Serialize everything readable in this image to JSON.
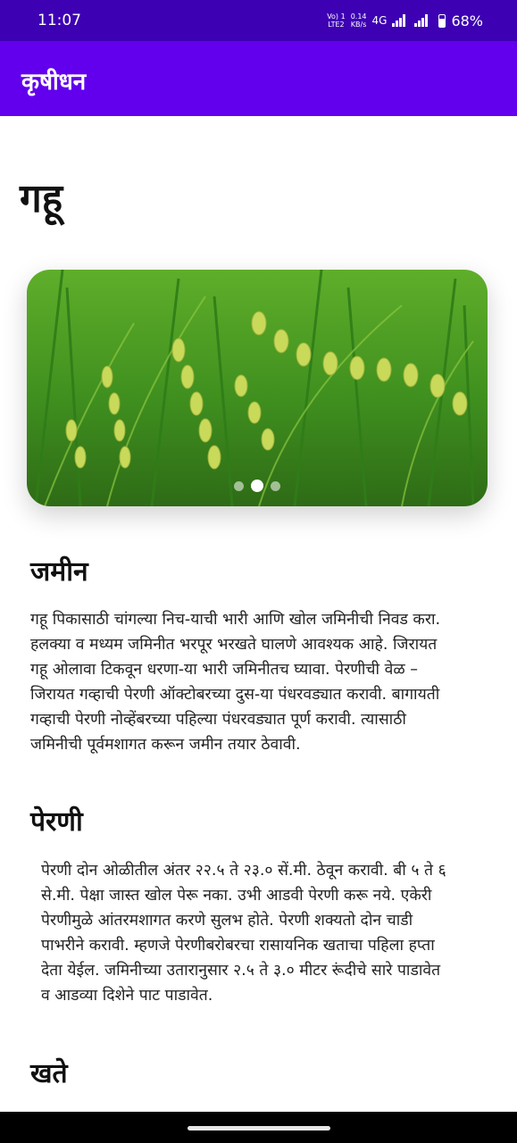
{
  "status_bar": {
    "time": "11:07",
    "carrier_top": "Vo) 1",
    "carrier_bottom": "LTE2",
    "speed_value": "0.14",
    "speed_unit": "KB/s",
    "network": "4G",
    "battery": "68%"
  },
  "app_bar": {
    "title": "कृषीधन"
  },
  "crop": {
    "title": "गहू",
    "carousel": {
      "slide_count": 3,
      "active_index": 1
    }
  },
  "sections": [
    {
      "title": "जमीन",
      "lines": [
        "गहू पिकासाठी चांगल्या निच-याची भारी आणि खोल जमिनीची निवड करा.",
        "हलक्या व मध्यम जमिनीत भरपूर भरखते घालणे आवश्यक आहे. जिरायत",
        "गहू ओलावा टिकवून धरणा-या भारी जमिनीतच घ्यावा. पेरणीची वेळ –",
        "जिरायत गव्हाची पेरणी ऑक्टोबरच्या दुस-या पंधरवड्यात करावी. बागायती",
        "गव्हाची पेरणी नोव्हेंबरच्या पहिल्या पंधरवड्यात पूर्ण करावी. त्यासाठी",
        "जमिनीची पूर्वमशागत करून जमीन तयार ठेवावी."
      ]
    },
    {
      "title": "पेरणी",
      "lines": [
        "पेरणी दोन ओळीतील अंतर २२.५ ते २३.० सें.मी. ठेवून करावी. बी ५ ते ६",
        "से.मी. पेक्षा जास्त खोल पेरू नका. उभी आडवी पेरणी करू नये. एकेरी",
        "पेरणीमुळे आंतरमशागत करणे सुलभ होते. पेरणी शक्यतो दोन चाडी",
        "पाभरीने करावी. म्हणजे पेरणीबरोबरचा रासायनिक खताचा पहिला हप्ता",
        "देता येईल. जमिनीच्या उतारानुसार २.५ ते ३.० मीटर रूंदीचे सारे पाडावेत",
        "व आडव्या दिशेने पाट पाडावेत."
      ]
    },
    {
      "title": "खते"
    }
  ]
}
